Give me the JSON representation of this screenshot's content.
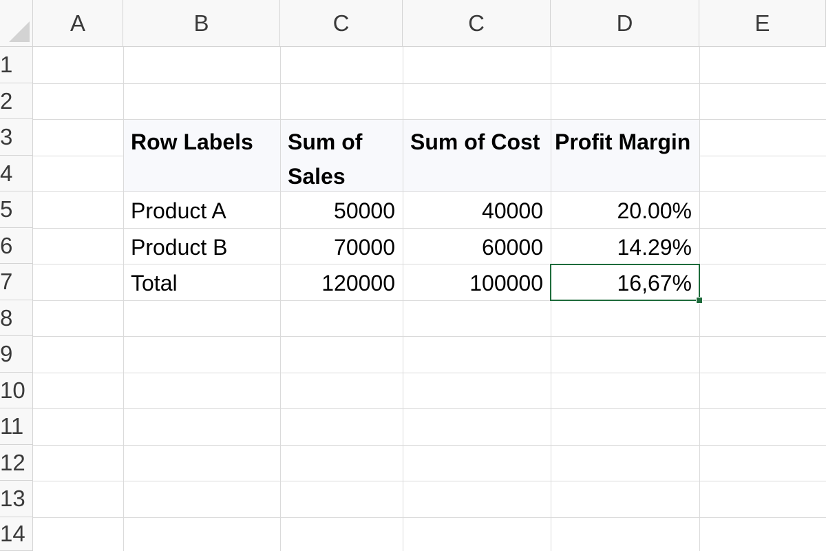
{
  "columns": [
    "A",
    "B",
    "C",
    "C",
    "D",
    "E"
  ],
  "rows": [
    "1",
    "2",
    "3",
    "4",
    "5",
    "6",
    "7",
    "8",
    "9",
    "10",
    "11",
    "12",
    "13",
    "14"
  ],
  "pivot": {
    "headers": {
      "row_labels": "Row Labels",
      "sum_of_sales_line1": "Sum of",
      "sum_of_sales_line2": "Sales",
      "sum_of_cost": "Sum of Cost",
      "profit_margin": "Profit Margin"
    },
    "data": [
      {
        "label": "Product A",
        "sales": "50000",
        "cost": "40000",
        "margin": "20.00%"
      },
      {
        "label": "Product B",
        "sales": "70000",
        "cost": "60000",
        "margin": "14.29%"
      },
      {
        "label": "Total",
        "sales": "120000",
        "cost": "100000",
        "margin": "16,67%"
      }
    ]
  },
  "selected_cell": "D7",
  "colors": {
    "selection": "#1e6b3b",
    "header_bg": "#f8f8f8",
    "gridline": "#dadada"
  }
}
